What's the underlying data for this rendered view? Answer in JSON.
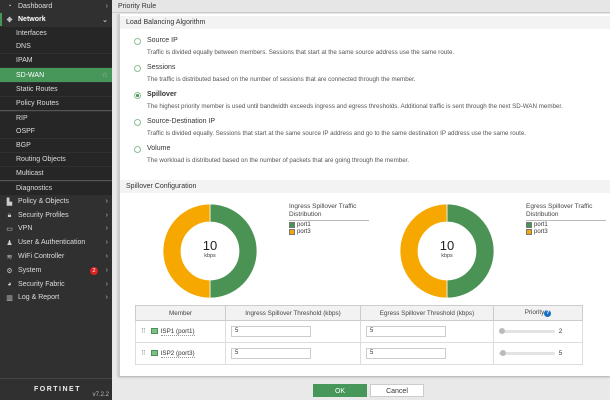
{
  "sidebar": {
    "items": [
      {
        "label": "Dashboard",
        "icon": "dashboard-icon"
      },
      {
        "label": "Network",
        "icon": "network-icon"
      },
      {
        "label": "Interfaces"
      },
      {
        "label": "DNS"
      },
      {
        "label": "IPAM"
      },
      {
        "label": "SD-WAN"
      },
      {
        "label": "Static Routes"
      },
      {
        "label": "Policy Routes"
      },
      {
        "label": "RIP"
      },
      {
        "label": "OSPF"
      },
      {
        "label": "BGP"
      },
      {
        "label": "Routing Objects"
      },
      {
        "label": "Multicast"
      },
      {
        "label": "Diagnostics"
      },
      {
        "label": "Policy & Objects",
        "icon": "policy-icon"
      },
      {
        "label": "Security Profiles",
        "icon": "lock-icon"
      },
      {
        "label": "VPN",
        "icon": "monitor-icon"
      },
      {
        "label": "User & Authentication",
        "icon": "user-icon"
      },
      {
        "label": "WiFi Controller",
        "icon": "wifi-icon"
      },
      {
        "label": "System",
        "icon": "gear-icon",
        "badge": "2"
      },
      {
        "label": "Security Fabric",
        "icon": "fabric-icon"
      },
      {
        "label": "Log & Report",
        "icon": "chart-icon"
      }
    ],
    "logo": "FORTINET",
    "version": "v7.2.2"
  },
  "header": {
    "title": "Priority Rule"
  },
  "algorithm": {
    "title": "Load Balancing Algorithm",
    "options": [
      {
        "label": "Source IP",
        "desc": "Traffic is divided equally between members. Sessions that start at the same source address use the same route.",
        "selected": false
      },
      {
        "label": "Sessions",
        "desc": "The traffic is distributed based on the number of sessions that are connected through the member.",
        "selected": false
      },
      {
        "label": "Spillover",
        "desc": "The highest priority member is used until bandwidth exceeds ingress and egress thresholds. Additional traffic is sent through the next SD-WAN member.",
        "selected": true
      },
      {
        "label": "Source-Destination IP",
        "desc": "Traffic is divided equally. Sessions that start at the same source IP address and go to the same destination IP address use the same route.",
        "selected": false
      },
      {
        "label": "Volume",
        "desc": "The workload is distributed based on the number of packets that are going through the member.",
        "selected": false
      }
    ]
  },
  "spillover": {
    "title": "Spillover Configuration",
    "charts": [
      {
        "title": "Ingress Spillover Traffic Distribution",
        "value": "10",
        "unit": "kbps",
        "legend": [
          {
            "label": "port1",
            "color": "#4a9355",
            "share": 5
          },
          {
            "label": "port3",
            "color": "#f7a800",
            "share": 5
          }
        ]
      },
      {
        "title": "Egress Spillover Traffic Distribution",
        "value": "10",
        "unit": "kbps",
        "legend": [
          {
            "label": "port1",
            "color": "#4a9355",
            "share": 5
          },
          {
            "label": "port3",
            "color": "#f7a800",
            "share": 5
          }
        ]
      }
    ],
    "table": {
      "headers": [
        "Member",
        "Ingress Spillover Threshold (kbps)",
        "Egress Spillover Threshold (kbps)",
        "Priority"
      ],
      "rows": [
        {
          "member": "ISP1 (port1)",
          "ingress": "5",
          "egress": "5",
          "priority": "2"
        },
        {
          "member": "ISP2 (port3)",
          "ingress": "5",
          "egress": "5",
          "priority": "5"
        }
      ]
    }
  },
  "buttons": {
    "ok": "OK",
    "cancel": "Cancel"
  }
}
